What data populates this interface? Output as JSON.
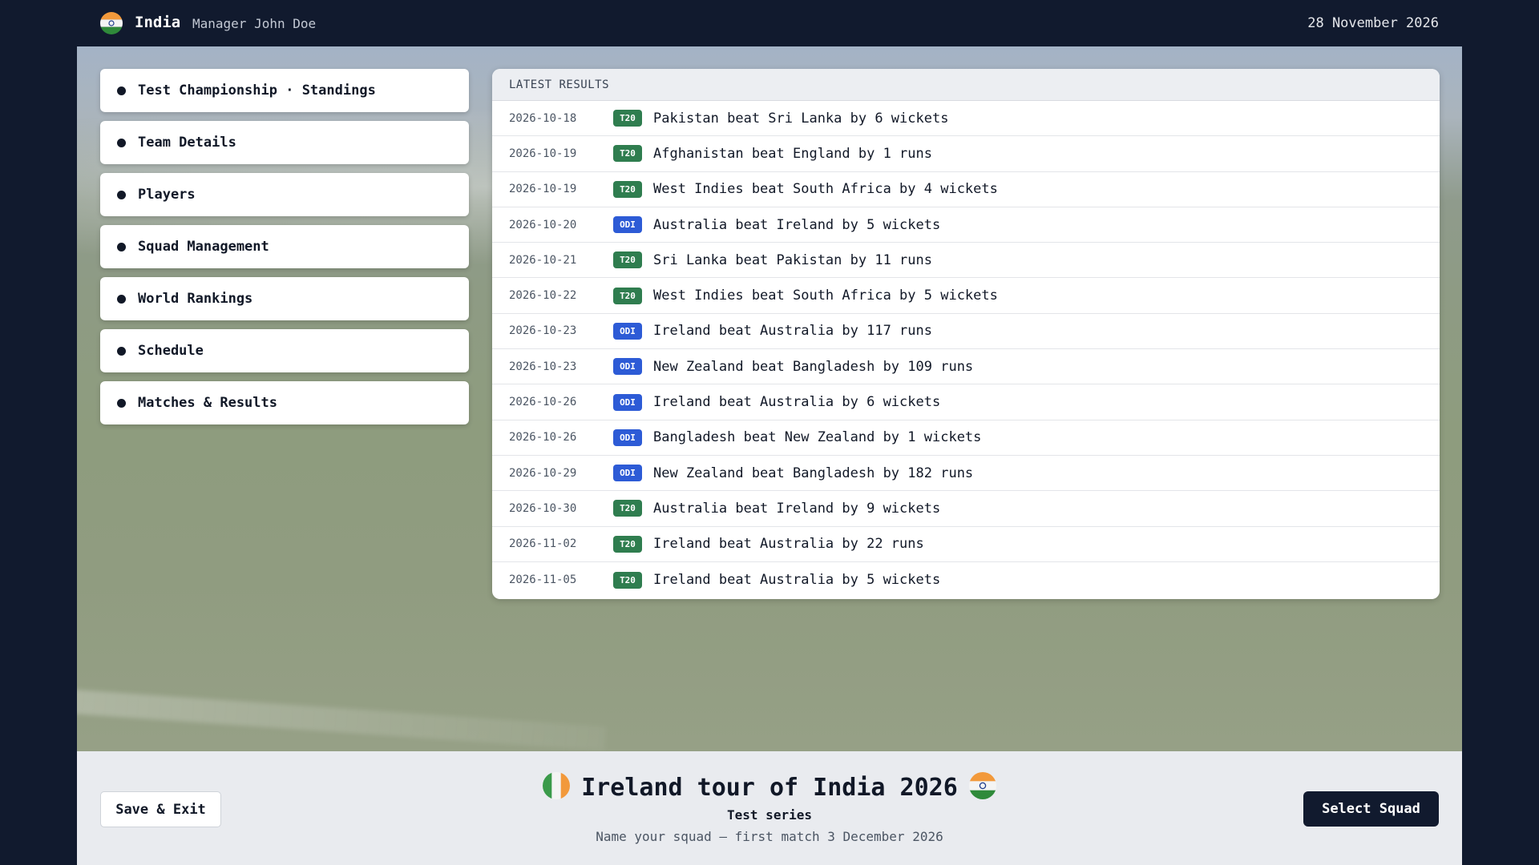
{
  "header": {
    "team": "India",
    "manager": "Manager John Doe",
    "date": "28 November 2026"
  },
  "menu": {
    "items": [
      {
        "label": "Test Championship · Standings"
      },
      {
        "label": "Team Details"
      },
      {
        "label": "Players"
      },
      {
        "label": "Squad Management"
      },
      {
        "label": "World Rankings"
      },
      {
        "label": "Schedule"
      },
      {
        "label": "Matches & Results"
      }
    ]
  },
  "results": {
    "title": "LATEST RESULTS",
    "rows": [
      {
        "date": "2026-10-18",
        "format": "T20",
        "text": "Pakistan beat Sri Lanka by 6 wickets"
      },
      {
        "date": "2026-10-19",
        "format": "T20",
        "text": "Afghanistan beat England by 1 runs"
      },
      {
        "date": "2026-10-19",
        "format": "T20",
        "text": "West Indies beat South Africa by 4 wickets"
      },
      {
        "date": "2026-10-20",
        "format": "ODI",
        "text": "Australia beat Ireland by 5 wickets"
      },
      {
        "date": "2026-10-21",
        "format": "T20",
        "text": "Sri Lanka beat Pakistan by 11 runs"
      },
      {
        "date": "2026-10-22",
        "format": "T20",
        "text": "West Indies beat South Africa by 5 wickets"
      },
      {
        "date": "2026-10-23",
        "format": "ODI",
        "text": "Ireland beat Australia by 117 runs"
      },
      {
        "date": "2026-10-23",
        "format": "ODI",
        "text": "New Zealand beat Bangladesh by 109 runs"
      },
      {
        "date": "2026-10-26",
        "format": "ODI",
        "text": "Ireland beat Australia by 6 wickets"
      },
      {
        "date": "2026-10-26",
        "format": "ODI",
        "text": "Bangladesh beat New Zealand by 1 wickets"
      },
      {
        "date": "2026-10-29",
        "format": "ODI",
        "text": "New Zealand beat Bangladesh by 182 runs"
      },
      {
        "date": "2026-10-30",
        "format": "T20",
        "text": "Australia beat Ireland by 9 wickets"
      },
      {
        "date": "2026-11-02",
        "format": "T20",
        "text": "Ireland beat Australia by 22 runs"
      },
      {
        "date": "2026-11-05",
        "format": "T20",
        "text": "Ireland beat Australia by 5 wickets"
      }
    ]
  },
  "colors": {
    "T20": "#2f7d4f",
    "ODI": "#2d5bd6",
    "navy": "#111a2e"
  },
  "bottom": {
    "save_label": "Save & Exit",
    "squad_label": "Select Squad",
    "tour_title": "Ireland tour of India 2026",
    "tour_sub": "Test series",
    "tour_note": "Name your squad — first match 3 December 2026"
  },
  "icons": {
    "flag_home": "india-flag-icon",
    "flag_away": "ireland-flag-icon"
  }
}
